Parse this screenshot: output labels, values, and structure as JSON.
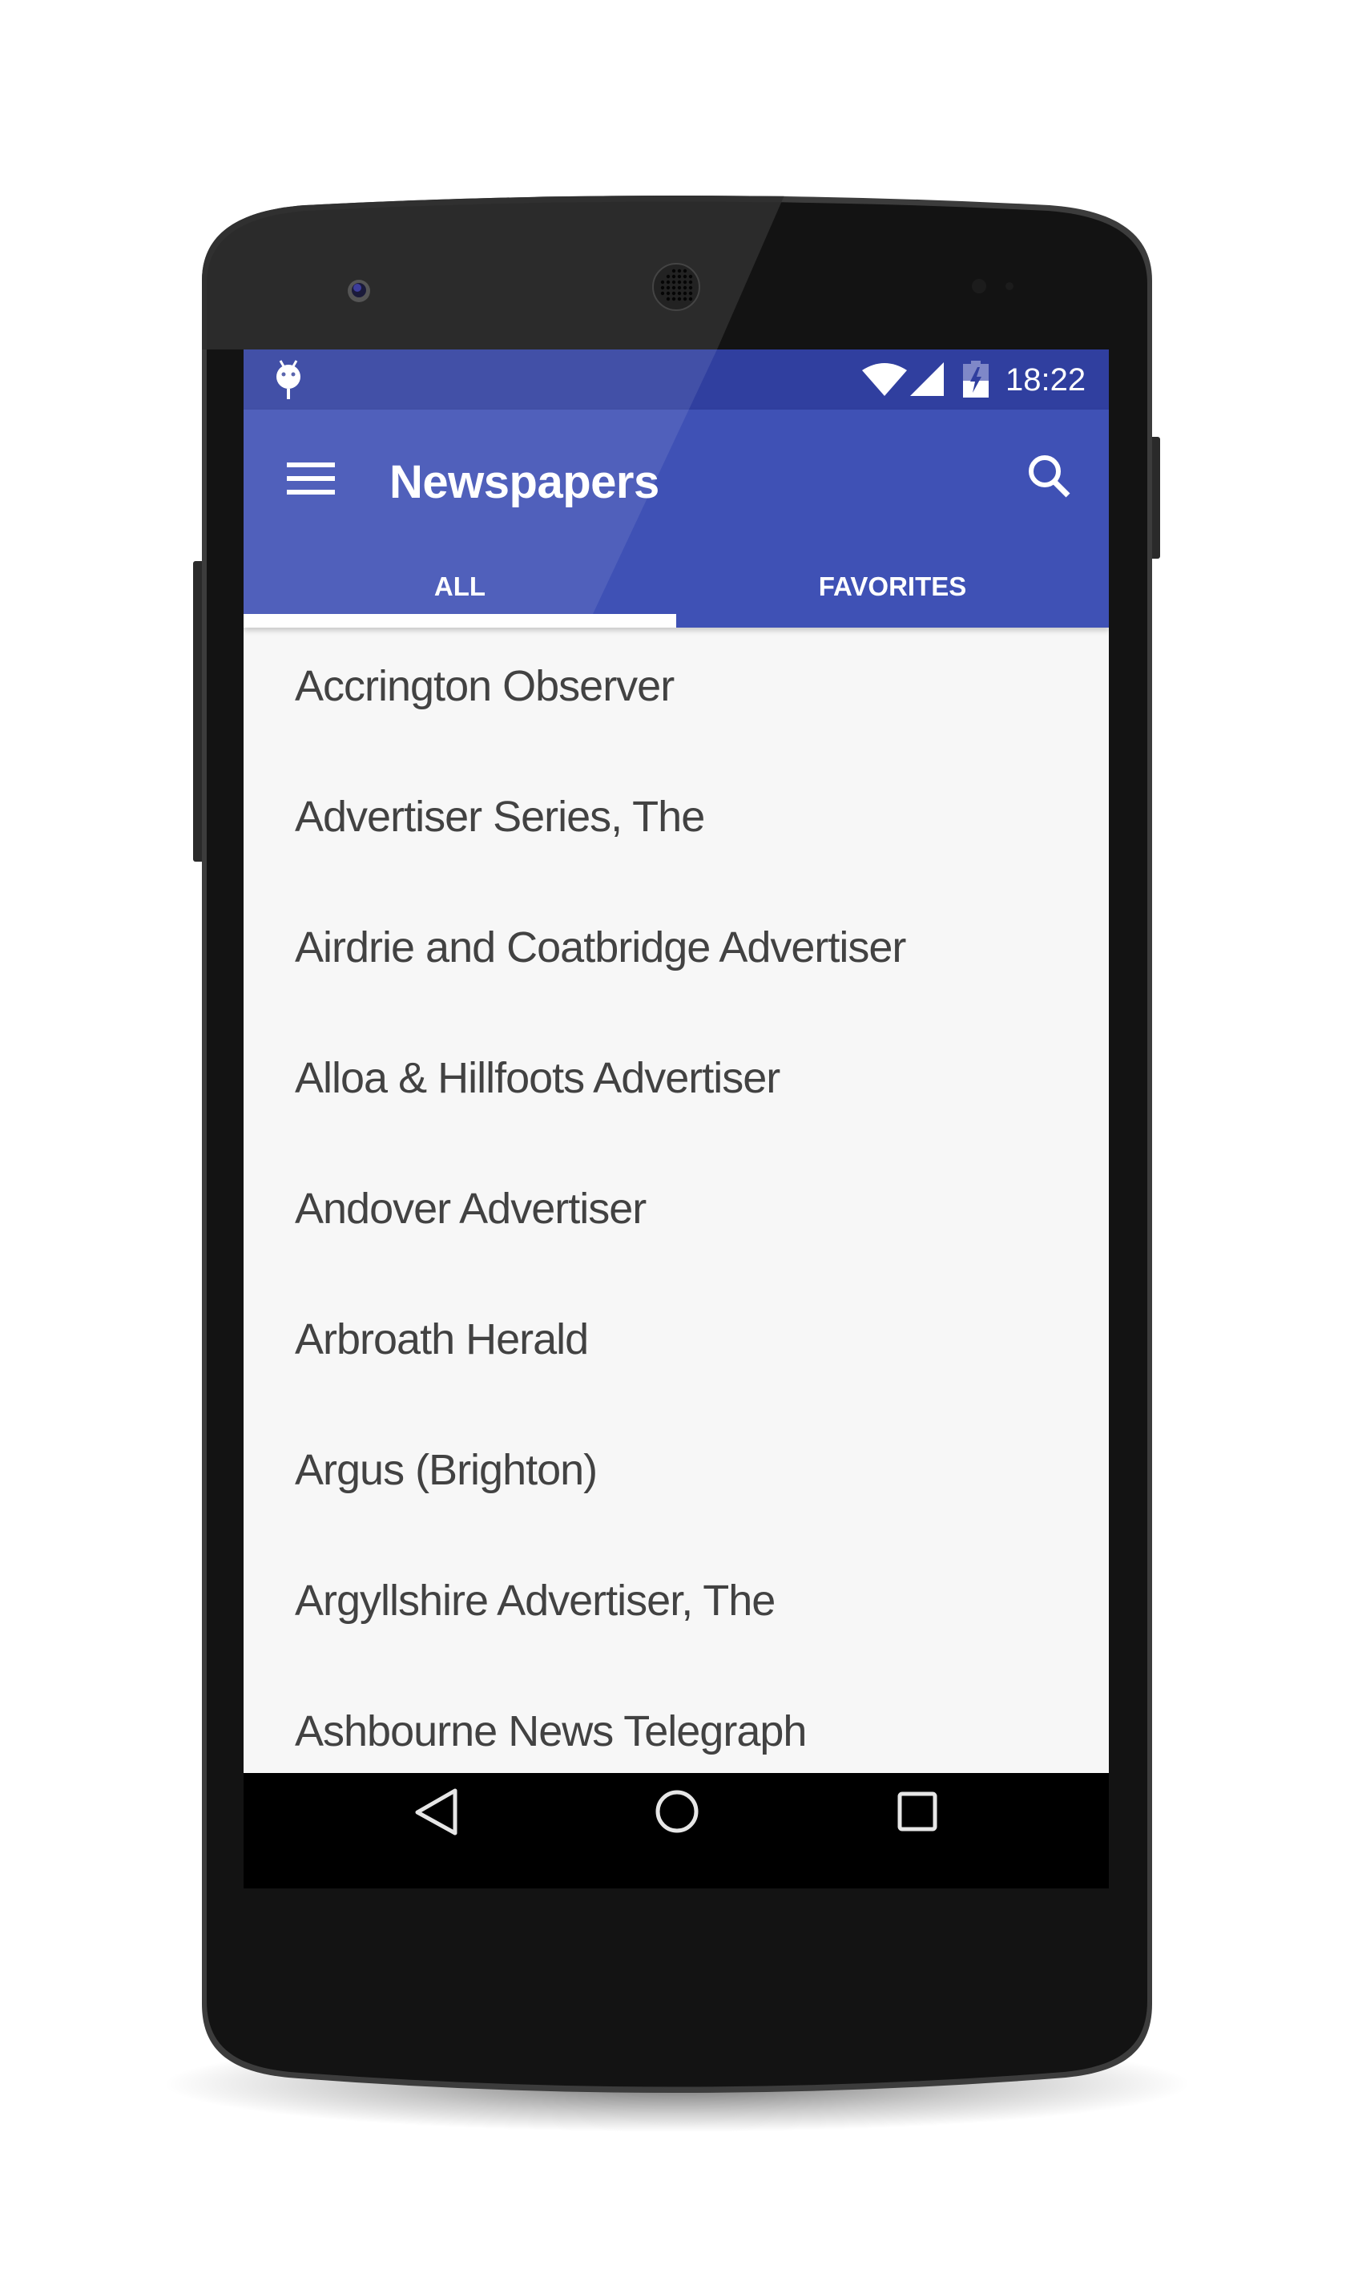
{
  "status_bar": {
    "time": "18:22",
    "icons": [
      "android-debug-icon",
      "wifi-icon",
      "cellular-signal-icon",
      "battery-charging-icon"
    ],
    "battery_level": 0.5
  },
  "toolbar": {
    "menu_icon": "hamburger-menu-icon",
    "title": "Newspapers",
    "search_icon": "search-icon"
  },
  "tabs": [
    {
      "label": "ALL",
      "selected": true
    },
    {
      "label": "FAVORITES",
      "selected": false
    }
  ],
  "list": {
    "items": [
      {
        "label": "Accrington Observer"
      },
      {
        "label": "Advertiser Series, The"
      },
      {
        "label": "Airdrie and Coatbridge Advertiser"
      },
      {
        "label": "Alloa & Hillfoots Advertiser"
      },
      {
        "label": "Andover Advertiser"
      },
      {
        "label": "Arbroath Herald"
      },
      {
        "label": "Argus (Brighton)"
      },
      {
        "label": "Argyllshire Advertiser, The"
      },
      {
        "label": "Ashbourne News Telegraph"
      }
    ]
  },
  "nav_bar": {
    "buttons": [
      "back-icon",
      "home-icon",
      "recents-icon"
    ]
  },
  "colors": {
    "primary": "#3F51B5",
    "primary_dark": "#303F9F",
    "list_background": "#F7F7F7",
    "list_text": "#424242",
    "indicator": "#FFFFFF"
  }
}
